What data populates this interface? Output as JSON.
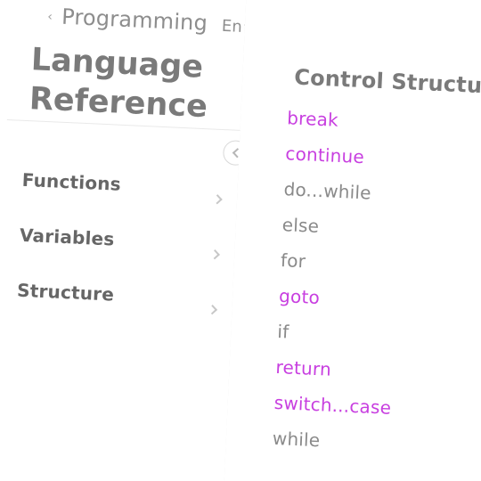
{
  "header": {
    "back_label": "Programming",
    "language_label": "En"
  },
  "left": {
    "title": "Language\nReference",
    "nav": [
      {
        "label": "Functions"
      },
      {
        "label": "Variables"
      },
      {
        "label": "Structure"
      }
    ]
  },
  "right": {
    "section_title": "Control Structure",
    "keywords": [
      {
        "label": "break",
        "style": "link"
      },
      {
        "label": "continue",
        "style": "link"
      },
      {
        "label": "do...while",
        "style": "plain"
      },
      {
        "label": "else",
        "style": "plain"
      },
      {
        "label": "for",
        "style": "plain"
      },
      {
        "label": "goto",
        "style": "link"
      },
      {
        "label": "if",
        "style": "plain"
      },
      {
        "label": "return",
        "style": "link"
      },
      {
        "label": "switch...case",
        "style": "link"
      },
      {
        "label": "while",
        "style": "plain"
      }
    ]
  },
  "icons": {
    "back": "back-arrow-icon",
    "language_dropdown": "chevron-down-icon",
    "collapse_sidebar": "chevron-left-icon",
    "nav_chevron": "chevron-right-icon"
  },
  "colors": {
    "link": "#c83fe0",
    "text": "#8a8a8a",
    "heading": "#7a7a7a",
    "divider": "#e9e9e9"
  }
}
